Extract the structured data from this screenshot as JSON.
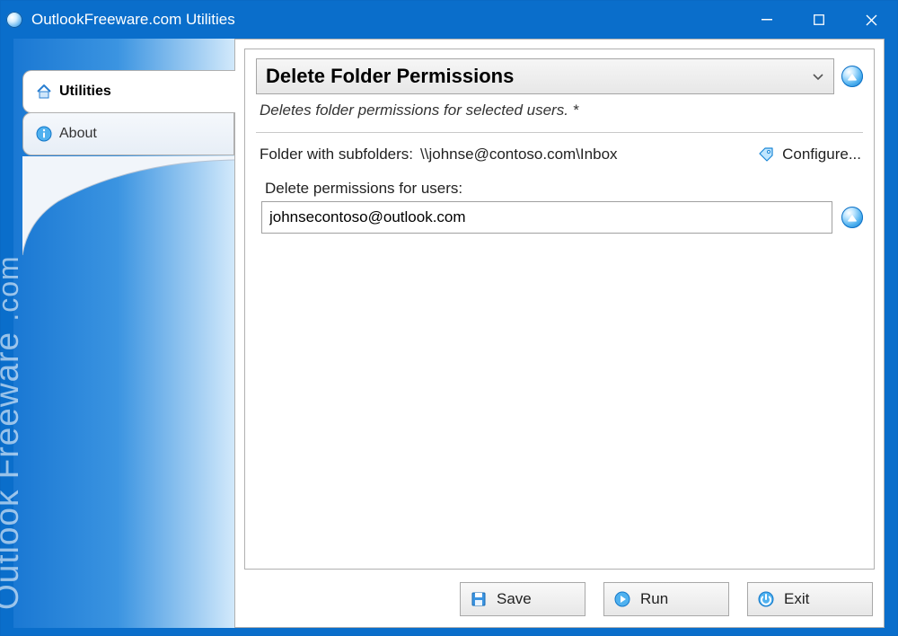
{
  "window": {
    "title": "OutlookFreeware.com Utilities"
  },
  "sidebar": {
    "tabs": [
      {
        "label": "Utilities",
        "active": true
      },
      {
        "label": "About",
        "active": false
      }
    ],
    "brand_main": "Outlook Freeware",
    "brand_domain": ".com"
  },
  "panel": {
    "heading": "Delete Folder Permissions",
    "description": "Deletes folder permissions for selected users. *",
    "folder_label": "Folder with subfolders:",
    "folder_value": "\\\\johnse@contoso.com\\Inbox",
    "configure_label": "Configure...",
    "perm_label": "Delete permissions for users:",
    "perm_value": "johnsecontoso@outlook.com"
  },
  "footer": {
    "save": "Save",
    "run": "Run",
    "exit": "Exit"
  }
}
